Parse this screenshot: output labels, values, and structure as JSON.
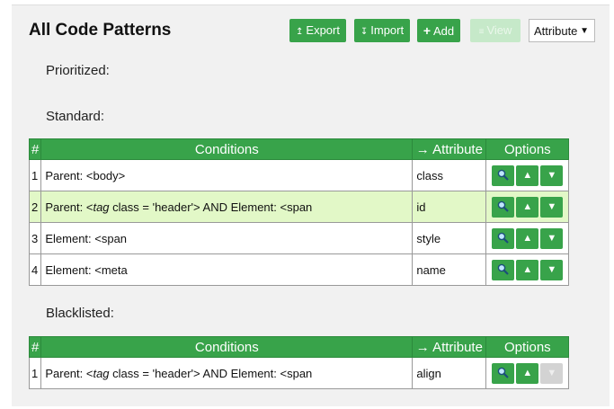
{
  "header": {
    "title": "All Code Patterns",
    "buttons": {
      "export": {
        "label": "Export",
        "icon": "↥"
      },
      "import": {
        "label": "Import",
        "icon": "↧"
      },
      "add": {
        "label": "Add",
        "icon": "+"
      },
      "view": {
        "label": "View",
        "icon": "≡"
      }
    },
    "select": {
      "value": "Attribute"
    }
  },
  "sections": {
    "prioritized": "Prioritized:",
    "standard": "Standard:",
    "blacklisted": "Blacklisted:"
  },
  "columns": {
    "num": "#",
    "conditions": "Conditions",
    "attribute": "→ Attribute",
    "options": "Options"
  },
  "standard_rows": [
    {
      "num": "1",
      "cond_a": "Parent: <body>",
      "cond_tag": "",
      "cond_b": "",
      "attr": "class"
    },
    {
      "num": "2",
      "cond_a": "Parent: <",
      "cond_tag": "tag",
      "cond_b": " class = 'header'> AND Element: <span",
      "attr": "id"
    },
    {
      "num": "3",
      "cond_a": "Element: <span",
      "cond_tag": "",
      "cond_b": "",
      "attr": "style"
    },
    {
      "num": "4",
      "cond_a": "Element: <meta",
      "cond_tag": "",
      "cond_b": "",
      "attr": "name"
    }
  ],
  "blacklisted_rows": [
    {
      "num": "1",
      "cond_a": "Parent: <",
      "cond_tag": "tag",
      "cond_b": " class = 'header'> AND Element: <span",
      "attr": "align"
    }
  ],
  "colors": {
    "accent": "#38a34a",
    "highlight_row": "#e2f8c7",
    "disabled": "#c6e9c9"
  }
}
